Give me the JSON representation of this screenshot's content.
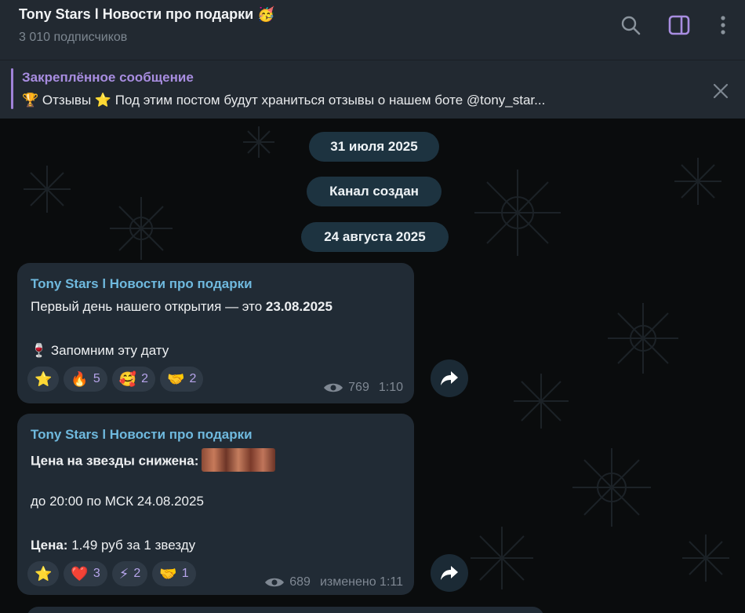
{
  "header": {
    "title": "Tony Stars l Новости про подарки",
    "title_emoji": "🥳",
    "subscribers": "3 010 подписчиков",
    "icons": [
      "search-icon",
      "sidebar-toggle-icon",
      "more-vert-icon"
    ]
  },
  "pinned": {
    "label": "Закреплённое сообщение",
    "text": "🏆 Отзывы ⭐ Под этим постом будут храниться отзывы о нашем боте @tony_star..."
  },
  "service": {
    "date1": "31 июля 2025",
    "created": "Канал создан",
    "date2": "24 августа 2025"
  },
  "messages": [
    {
      "author": "Tony Stars l Новости про подарки",
      "line1_text": "Первый день нашего открытия — это ",
      "line1_bold": "23.08.2025",
      "line2_emoji": "🍷",
      "line2_text": "Запомним эту дату",
      "reactions": [
        {
          "emoji": "⭐",
          "count": ""
        },
        {
          "emoji": "🔥",
          "count": "5"
        },
        {
          "emoji": "🥰",
          "count": "2"
        },
        {
          "emoji": "🤝",
          "count": "2"
        }
      ],
      "views": "769",
      "time": "1:10"
    },
    {
      "author": "Tony Stars l Новости про подарки",
      "line1_bold": "Цена на звезды снижена:",
      "line2_text": "до 20:00 по МСК 24.08.2025",
      "line3_bold": "Цена:",
      "line3_text": " 1.49 руб за 1 звезду",
      "reactions": [
        {
          "emoji": "⭐",
          "count": ""
        },
        {
          "emoji": "❤️",
          "count": "3"
        },
        {
          "emoji": "⚡",
          "count": "2"
        },
        {
          "emoji": "🤝",
          "count": "1"
        }
      ],
      "views": "689",
      "time": "изменено 1:11"
    }
  ],
  "colors": {
    "header_bg": "#222931",
    "accent_purple": "#a88de0",
    "author_blue": "#6fb9de",
    "bubble_bg": "#212b35",
    "pill_bg": "#1d3340",
    "reaction_count": "#b6a4ea"
  }
}
